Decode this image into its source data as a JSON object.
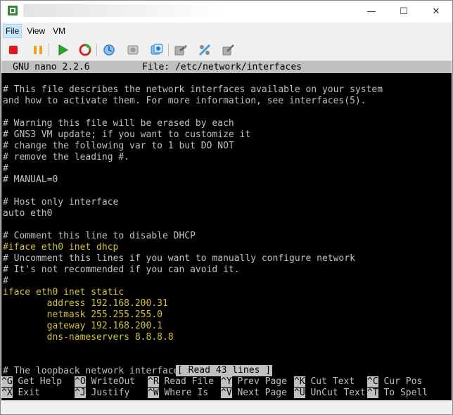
{
  "window": {
    "controls": {
      "minimize": "—",
      "maximize": "☐",
      "close": "✕"
    }
  },
  "menu": {
    "file": "File",
    "view": "View",
    "vm": "VM"
  },
  "toolbar": {
    "buttons": [
      {
        "name": "stop",
        "color": "#e0161b"
      },
      {
        "name": "pause",
        "color": "#e8a317"
      },
      {
        "name": "start",
        "color": "#2ea52e"
      },
      {
        "name": "reset",
        "color": "#d02a1e"
      },
      {
        "name": "snapshot",
        "color": "#2f7fd0"
      },
      {
        "name": "revert",
        "color": "#8a8a8a"
      },
      {
        "name": "manage-snapshots",
        "color": "#2f7fd0"
      },
      {
        "name": "settings",
        "color": "#8a8a8a"
      },
      {
        "name": "network",
        "color": "#3aa0d0"
      },
      {
        "name": "tools",
        "color": "#8a8a8a"
      }
    ]
  },
  "nano": {
    "version": "GNU nano 2.2.6",
    "file_label": "File: /etc/network/interfaces",
    "lines": [
      {
        "text": "",
        "color": "gray"
      },
      {
        "text": "# This file describes the network interfaces available on your system",
        "color": "gray"
      },
      {
        "text": "and how to activate them. For more information, see interfaces(5).",
        "color": "gray"
      },
      {
        "text": "",
        "color": "gray"
      },
      {
        "text": "# Warning this file will be erased by each",
        "color": "gray"
      },
      {
        "text": "# GNS3 VM update; if you want to customize it",
        "color": "gray"
      },
      {
        "text": "# change the following var to 1 but DO NOT",
        "color": "gray"
      },
      {
        "text": "# remove the leading #.",
        "color": "gray"
      },
      {
        "text": "#",
        "color": "gray"
      },
      {
        "text": "# MANUAL=0",
        "color": "gray"
      },
      {
        "text": "",
        "color": "gray"
      },
      {
        "text": "# Host only interface",
        "color": "gray"
      },
      {
        "text": "auto eth0",
        "color": "gray"
      },
      {
        "text": "",
        "color": "gray"
      },
      {
        "text": "# Comment this line to disable DHCP",
        "color": "gray"
      },
      {
        "text": "#iface eth0 inet dhcp",
        "color": "yellow"
      },
      {
        "text": "# Uncomment this lines if you want to manually configure network",
        "color": "gray"
      },
      {
        "text": "# It's not recommended if you can avoid it.",
        "color": "gray"
      },
      {
        "text": "#",
        "color": "gray"
      },
      {
        "text": "iface eth0 inet static",
        "color": "yellow"
      },
      {
        "text": "        address 192.168.200.31",
        "color": "yellow"
      },
      {
        "text": "        netmask 255.255.255.0",
        "color": "yellow"
      },
      {
        "text": "        gateway 192.168.200.1",
        "color": "yellow"
      },
      {
        "text": "        dns-nameservers 8.8.8.8",
        "color": "yellow"
      },
      {
        "text": "",
        "color": "gray"
      },
      {
        "text": "",
        "color": "gray"
      },
      {
        "text": "# The loopback network interface",
        "color": "gray"
      }
    ],
    "status": "[ Read 43 lines ]",
    "shortcuts_row1": [
      {
        "key": "^G",
        "label": " Get Help"
      },
      {
        "key": "^O",
        "label": " WriteOut"
      },
      {
        "key": "^R",
        "label": " Read File"
      },
      {
        "key": "^Y",
        "label": " Prev Page"
      },
      {
        "key": "^K",
        "label": " Cut Text"
      },
      {
        "key": "^C",
        "label": " Cur Pos"
      }
    ],
    "shortcuts_row2": [
      {
        "key": "^X",
        "label": " Exit"
      },
      {
        "key": "^J",
        "label": " Justify"
      },
      {
        "key": "^W",
        "label": " Where Is"
      },
      {
        "key": "^V",
        "label": " Next Page"
      },
      {
        "key": "^U",
        "label": " UnCut Text"
      },
      {
        "key": "^T",
        "label": " To Spell"
      }
    ]
  }
}
